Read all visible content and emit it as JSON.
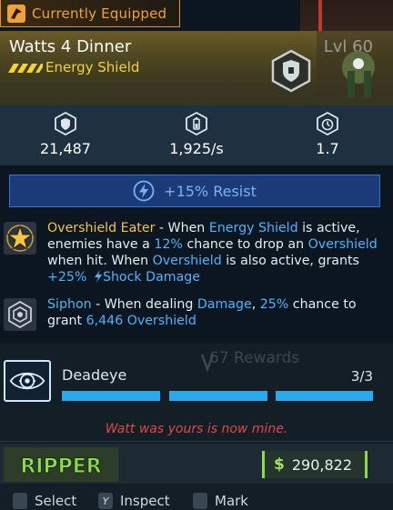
{
  "tab": {
    "label": "Currently Equipped",
    "icon": "equipped-shield-icon"
  },
  "item": {
    "name": "Watts 4 Dinner",
    "level": "Lvl 60",
    "type": "Energy Shield",
    "badge_icon": "shield-badge-icon",
    "rarity_color": "#f4d23a"
  },
  "stats": [
    {
      "icon": "shield-capacity-icon",
      "value": "21,487"
    },
    {
      "icon": "recharge-rate-icon",
      "value": "1,925/s"
    },
    {
      "icon": "recharge-delay-icon",
      "value": "1.7"
    }
  ],
  "resist": {
    "icon": "lightning-icon",
    "text": "+15% Resist"
  },
  "perks": [
    {
      "icon": "star-burst-icon",
      "parts": {
        "p1": "Overshield Eater",
        "p2": " - When ",
        "p3": "Energy Shield",
        "p4": " is active, enemies have a ",
        "p5": "12%",
        "p6": " chance to drop an ",
        "p7": "Overshield",
        "p8": " when hit. When ",
        "p9": "Overshield",
        "p10": " is also active, grants ",
        "p11": "+25%",
        "p12": "Shock Damage"
      }
    },
    {
      "icon": "siphon-icon",
      "parts": {
        "p1": "Siphon",
        "p2": " - When dealing ",
        "p3": "Damage",
        "p4": ", ",
        "p5": "25%",
        "p6": " chance to grant ",
        "p7": "6,446 Overshield"
      }
    }
  ],
  "background_text": "67 Rewards",
  "deadeye": {
    "icon": "eye-target-icon",
    "name": "Deadeye",
    "count": "3/3",
    "filled_segments": 3,
    "total_segments": 3
  },
  "flavor_text": "Watt was yours is now mine.",
  "manufacturer": {
    "logo_text": "RIPPER",
    "logo_color": "#8cdc4a"
  },
  "price": {
    "currency_symbol": "$",
    "amount": "290,822"
  },
  "hints": [
    {
      "key": "",
      "label": "Select"
    },
    {
      "key": "Y",
      "label": "Inspect"
    },
    {
      "key": "",
      "label": "Mark"
    }
  ]
}
